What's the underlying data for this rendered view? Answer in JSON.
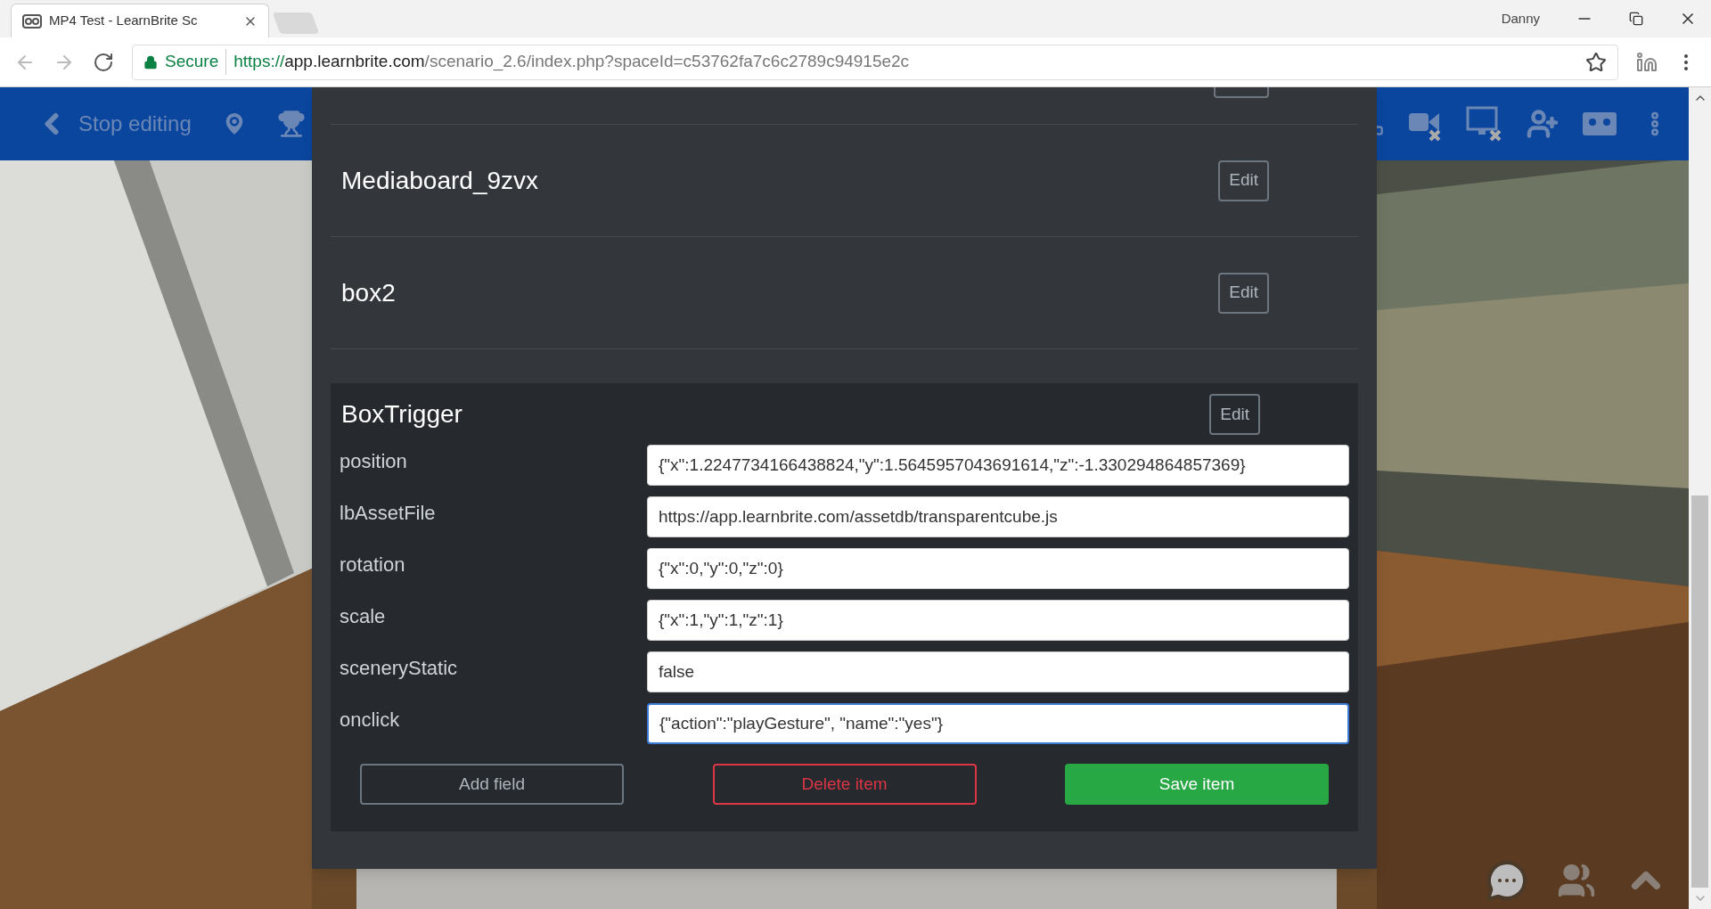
{
  "browser": {
    "tab_title": "MP4 Test - LearnBrite Sc",
    "profile": "Danny",
    "secure_label": "Secure",
    "url_scheme": "https://",
    "url_host": "app.learnbrite.com",
    "url_path": "/scenario_2.6/index.php?spaceId=c53762fa7c6c2789c94915e2c"
  },
  "toolbar": {
    "back_label": "Stop editing"
  },
  "items": [
    {
      "kind": "clipped"
    },
    {
      "kind": "row",
      "name": "Mediaboard_9zvx",
      "edit": "Edit"
    },
    {
      "kind": "row",
      "name": "box2",
      "edit": "Edit"
    },
    {
      "kind": "open",
      "name": "BoxTrigger",
      "edit": "Edit",
      "fields": [
        {
          "label": "position",
          "value": "{\"x\":1.2247734166438824,\"y\":1.5645957043691614,\"z\":-1.330294864857369}",
          "focused": false
        },
        {
          "label": "lbAssetFile",
          "value": "https://app.learnbrite.com/assetdb/transparentcube.js",
          "focused": false
        },
        {
          "label": "rotation",
          "value": "{\"x\":0,\"y\":0,\"z\":0}",
          "focused": false
        },
        {
          "label": "scale",
          "value": "{\"x\":1,\"y\":1,\"z\":1}",
          "focused": false
        },
        {
          "label": "sceneryStatic",
          "value": "false",
          "focused": false
        },
        {
          "label": "onclick",
          "value": "{\"action\":\"playGesture\", \"name\":\"yes\"}",
          "focused": true
        }
      ],
      "actions": [
        {
          "label": "Add field",
          "kind": "outline"
        },
        {
          "label": "Delete item",
          "kind": "danger"
        },
        {
          "label": "Save item",
          "kind": "primary"
        }
      ]
    }
  ]
}
